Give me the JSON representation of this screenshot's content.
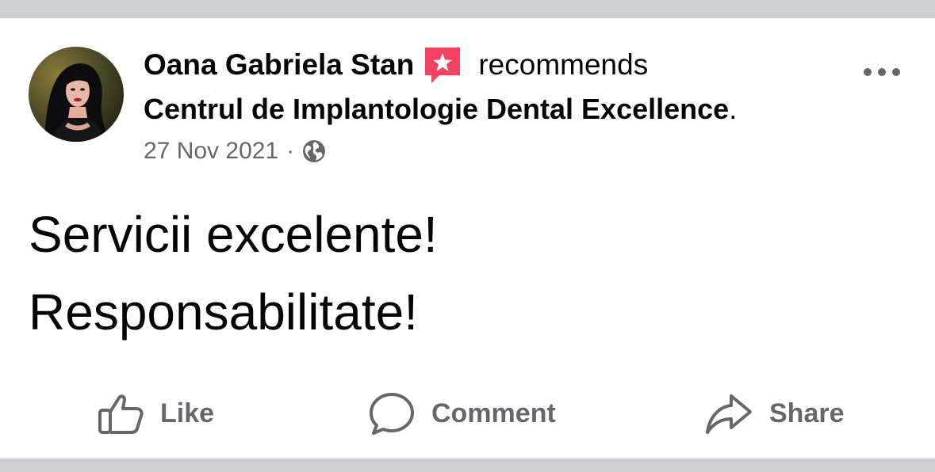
{
  "post": {
    "author": "Oana Gabriela Stan",
    "action_text": "recommends",
    "page_name": "Centrul de Implantologie Dental Excellence",
    "page_suffix": ".",
    "date": "27 Nov 2021",
    "separator": "·",
    "audience_icon": "globe-icon",
    "recommend_icon": "recommend-star-icon",
    "menu_icon": "more-options-icon",
    "text_lines": [
      "Servicii excelente!",
      "Responsabilitate!"
    ]
  },
  "actions": {
    "like": {
      "label": "Like",
      "icon": "thumbs-up-icon"
    },
    "comment": {
      "label": "Comment",
      "icon": "comment-bubble-icon"
    },
    "share": {
      "label": "Share",
      "icon": "share-arrow-icon"
    }
  },
  "colors": {
    "background": "#ccced3",
    "card": "#ffffff",
    "primary_text": "#050505",
    "secondary_text": "#65676b",
    "recommend_badge": "#f3425f"
  }
}
